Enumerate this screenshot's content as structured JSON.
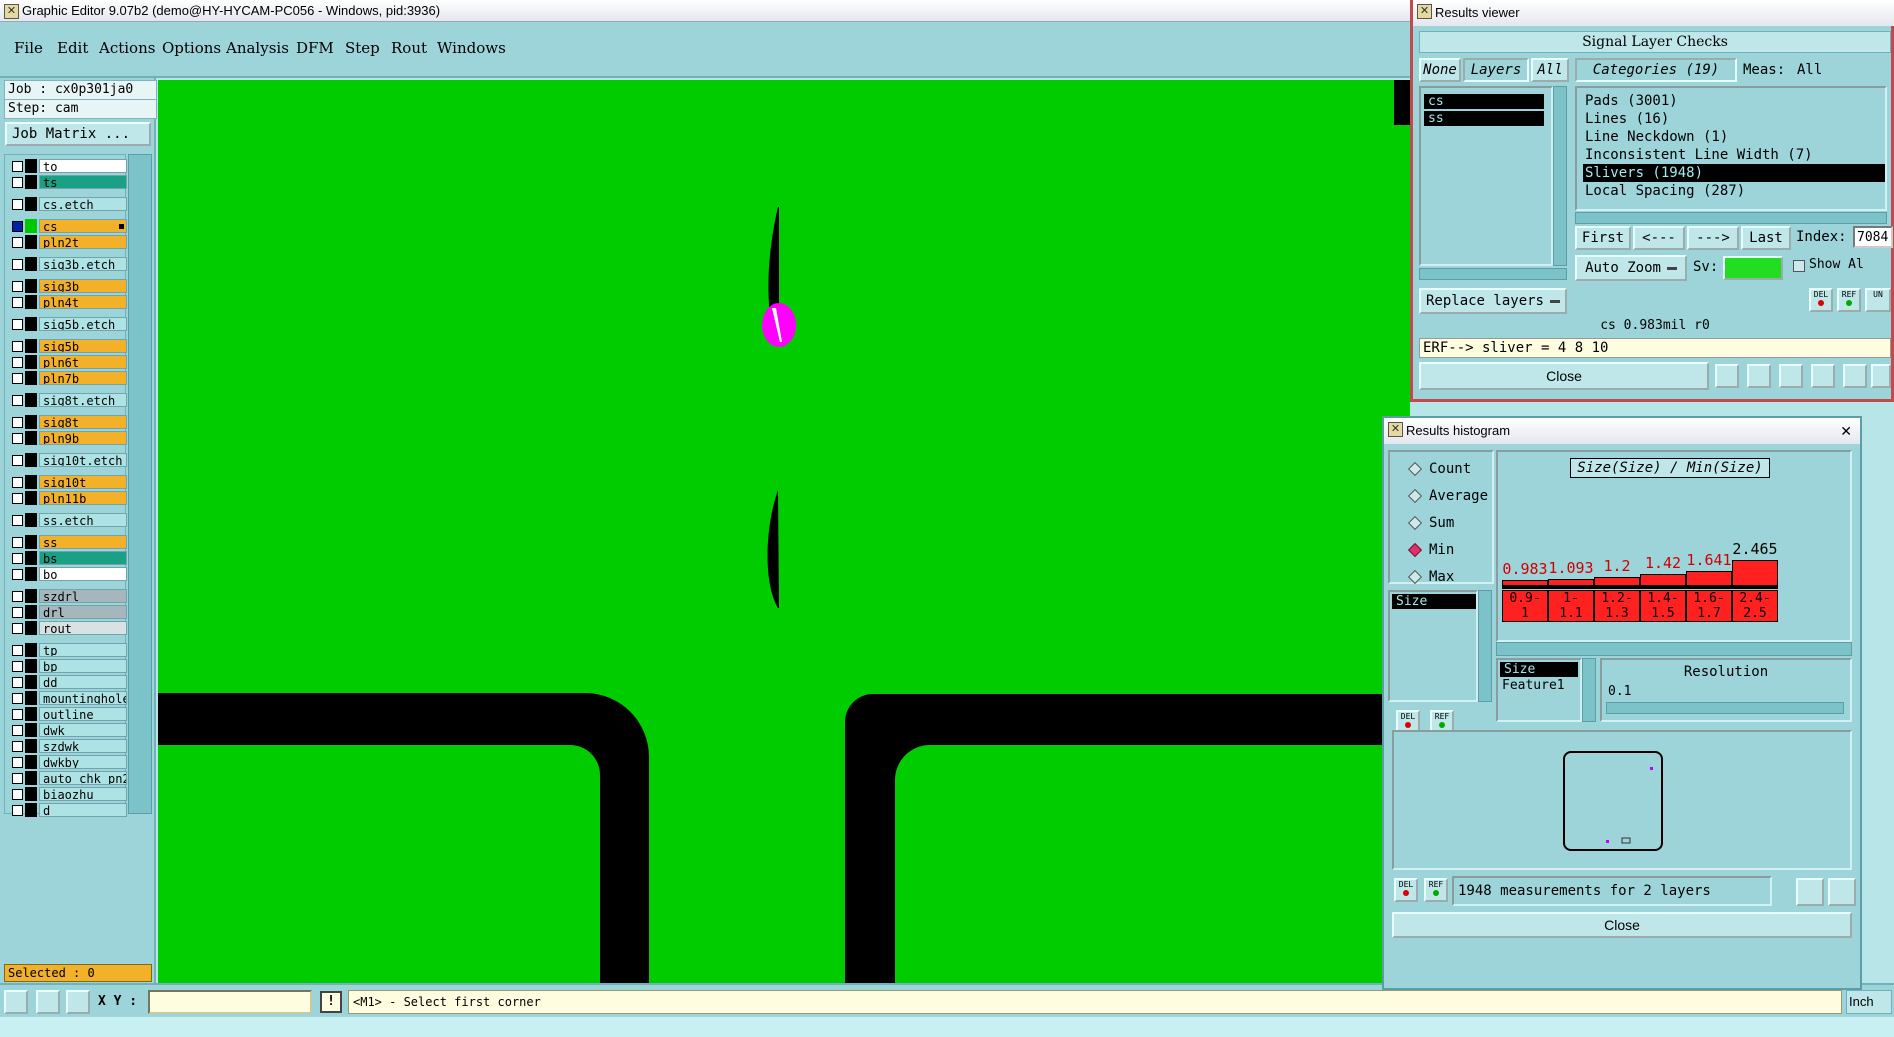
{
  "main": {
    "title": "Graphic Editor 9.07b2 (demo@HY-HYCAM-PC056 - Windows, pid:3936)",
    "menu": [
      "File",
      "Edit",
      "Actions",
      "Options",
      "Analysis",
      "DFM",
      "Step",
      "Rout",
      "Windows"
    ],
    "job_line": "Job : cx0p301ja0",
    "step_line": "Step: cam",
    "job_matrix_label": "Job Matrix ...",
    "layers": [
      {
        "name": "to",
        "color": "white"
      },
      {
        "name": "ts",
        "color": "teal"
      },
      {
        "name": "cs.etch",
        "color": "cyan"
      },
      {
        "name": "cs",
        "color": "orange",
        "active": true
      },
      {
        "name": "pln2t",
        "color": "orange"
      },
      {
        "name": "sig3b.etch",
        "color": "cyan"
      },
      {
        "name": "sig3b",
        "color": "orange"
      },
      {
        "name": "pln4t",
        "color": "orange"
      },
      {
        "name": "sig5b.etch",
        "color": "cyan"
      },
      {
        "name": "sig5b",
        "color": "orange"
      },
      {
        "name": "pln6t",
        "color": "orange"
      },
      {
        "name": "pln7b",
        "color": "orange"
      },
      {
        "name": "sig8t.etch",
        "color": "cyan"
      },
      {
        "name": "sig8t",
        "color": "orange"
      },
      {
        "name": "pln9b",
        "color": "orange"
      },
      {
        "name": "sig10t.etch",
        "color": "cyan"
      },
      {
        "name": "sig10t",
        "color": "orange"
      },
      {
        "name": "pln11b",
        "color": "orange"
      },
      {
        "name": "ss.etch",
        "color": "cyan"
      },
      {
        "name": "ss",
        "color": "orange"
      },
      {
        "name": "bs",
        "color": "teal"
      },
      {
        "name": "bo",
        "color": "white"
      },
      {
        "name": "szdrl",
        "color": "grey"
      },
      {
        "name": "drl",
        "color": "grey"
      },
      {
        "name": "rout",
        "color": "light"
      },
      {
        "name": "tp",
        "color": "cyan"
      },
      {
        "name": "bp",
        "color": "cyan"
      },
      {
        "name": "dd",
        "color": "cyan"
      },
      {
        "name": "mountinghole",
        "color": "cyan"
      },
      {
        "name": "outline",
        "color": "cyan"
      },
      {
        "name": "dwk",
        "color": "cyan"
      },
      {
        "name": "szdwk",
        "color": "cyan"
      },
      {
        "name": "dwkby",
        "color": "cyan"
      },
      {
        "name": "auto_chk_pn2",
        "color": "cyan"
      },
      {
        "name": "biaozhu",
        "color": "cyan"
      },
      {
        "name": "d",
        "color": "cyan"
      }
    ],
    "selected_status": "Selected : 0",
    "xy_label": "X Y :",
    "xy_value": "",
    "excl_label": "!",
    "prompt": "<M1> - Select first corner",
    "units": "Inch",
    "colors": {
      "canvas": "#00cc00",
      "panel": "#9dd4d9",
      "highlight": "#ff00ff"
    }
  },
  "results_viewer": {
    "title": "Results viewer",
    "header": "Signal Layer Checks",
    "tabs": {
      "none": "None",
      "layers": "Layers",
      "all": "All"
    },
    "layers": [
      "cs",
      "ss"
    ],
    "categories_label": "Categories (19)",
    "meas_label": "Meas:",
    "meas_value": "All",
    "categories": [
      "Pads (3001)",
      "Lines (16)",
      "Line Neckdown (1)",
      "Inconsistent Line Width (7)",
      "Slivers (1948)",
      "Local Spacing (287)"
    ],
    "selected_category_index": 4,
    "nav": {
      "first": "First",
      "prev": "<---",
      "next": "--->",
      "last": "Last"
    },
    "index_label": "Index:",
    "index_value": "7084",
    "auto_zoom_label": "Auto Zoom",
    "sv_label": "Sv:",
    "show_all_label": "Show Al",
    "replace_layers_label": "Replace layers",
    "del_label": "DEL",
    "ref_label": "REF",
    "un_label": "UN",
    "measurement": "cs 0.983mil  r0",
    "erf_line": "ERF--> sliver = 4 8 10",
    "close_label": "Close"
  },
  "histogram": {
    "title": "Results histogram",
    "options": [
      "Count",
      "Average",
      "Sum",
      "Min",
      "Max"
    ],
    "selected_option": "Min",
    "left_list": [
      "Size"
    ],
    "chart_title": "Size(Size) / Min(Size)",
    "del_label": "DEL",
    "ref_label": "REF",
    "chart_data": {
      "type": "bar",
      "title": "Size(Size) / Min(Size)",
      "categories": [
        "0.9-1",
        "1-1.1",
        "1.2-1.3",
        "1.4-1.5",
        "1.6-1.7",
        "2.4-2.5"
      ],
      "category_labels": [
        "0.9-\n1",
        "1-\n1.1",
        "1.2-\n1.3",
        "1.4-\n1.5",
        "1.6-\n1.7",
        "2.4-\n2.5"
      ],
      "values": [
        0.983,
        1.093,
        1.2,
        1.42,
        1.641,
        2.465
      ],
      "value_labels": [
        "0.983",
        "1.093",
        "1.2",
        "1.42",
        "1.641",
        "2.465"
      ],
      "ylim": [
        0,
        2.5
      ]
    },
    "attr_list": [
      "Size",
      "Feature1"
    ],
    "resolution_label": "Resolution",
    "resolution_value": "0.1",
    "summary": "1948 measurements for 2 layers",
    "close_label": "Close"
  }
}
